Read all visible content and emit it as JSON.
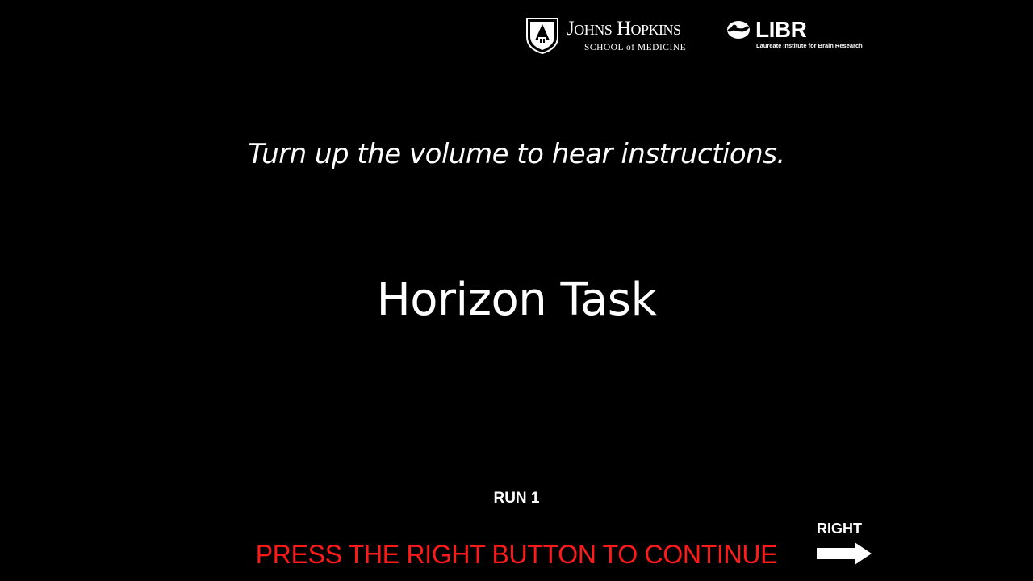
{
  "logos": {
    "jhu": {
      "name": "Johns Hopkins",
      "subtitle": "SCHOOL of MEDICINE"
    },
    "libr": {
      "name": "LIBR",
      "subtitle": "Laureate Institute for Brain Research"
    }
  },
  "instructions": {
    "volume_note": "Turn up the volume to hear instructions.",
    "title": "Horizon Task",
    "run_label": "RUN 1",
    "continue_prompt": "PRESS THE RIGHT BUTTON TO CONTINUE",
    "right_label": "RIGHT"
  },
  "icons": {
    "shield": "jhu-shield-icon",
    "libr_mark": "libr-mark-icon",
    "arrow": "right-arrow-icon"
  },
  "colors": {
    "background": "#000000",
    "text": "#ffffff",
    "prompt": "#ff1a1a"
  }
}
